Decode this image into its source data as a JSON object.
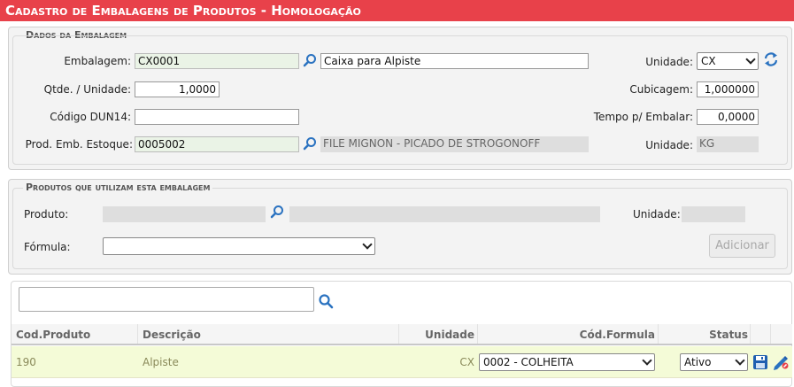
{
  "title": "Cadastro de Embalagens de Produtos  - Homologação",
  "dados": {
    "legend": "Dados da Embalagem",
    "embalagem_label": "Embalagem:",
    "embalagem_code": "CX0001",
    "embalagem_desc": "Caixa para Alpiste",
    "unidade_label": "Unidade:",
    "unidade_value": "CX",
    "qtde_label": "Qtde. / Unidade:",
    "qtde_value": "1,0000",
    "cubicagem_label": "Cubicagem:",
    "cubicagem_value": "1,000000",
    "dun_label": "Código DUN14:",
    "dun_value": "",
    "tempo_label": "Tempo p/ Embalar:",
    "tempo_value": "0,0000",
    "prod_label": "Prod. Emb. Estoque:",
    "prod_code": "0005002",
    "prod_desc": "FILE MIGNON - PICADO DE STROGONOFF",
    "unidade2_label": "Unidade:",
    "unidade2_value": "KG"
  },
  "produtos": {
    "legend": "Produtos que utilizam esta embalagem",
    "produto_label": "Produto:",
    "unidade_label": "Unidade:",
    "formula_label": "Fórmula:",
    "formula_value": "",
    "adicionar_label": "Adicionar"
  },
  "grid": {
    "search_placeholder": "",
    "headers": {
      "cod_produto": "Cod.Produto",
      "descricao": "Descrição",
      "unidade": "Unidade",
      "cod_formula": "Cód.Formula",
      "status": "Status"
    },
    "rows": [
      {
        "cod_produto": "190",
        "descricao": "Alpiste",
        "unidade": "CX",
        "cod_formula": "0002 - COLHEITA",
        "status": "Ativo"
      }
    ]
  },
  "icons": {
    "search": "search-icon",
    "refresh": "refresh-icon",
    "save": "save-icon",
    "edit": "edit-icon"
  },
  "colors": {
    "title_bg": "#e8414a",
    "row_highlight": "#f4fbd7",
    "icon_blue": "#2a72c0"
  }
}
